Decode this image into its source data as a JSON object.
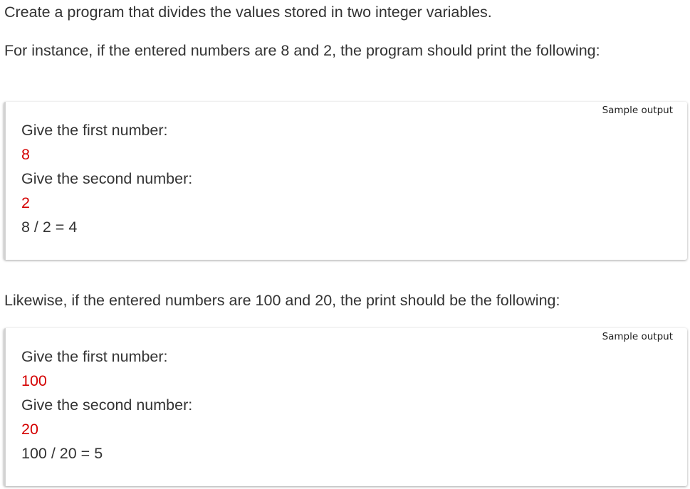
{
  "intro": "Create a program that divides the values stored in two integer variables.",
  "example1_text": "For instance, if the entered numbers are 8 and 2, the program should print the following:",
  "sample1": {
    "label": "Sample output",
    "lines": [
      {
        "text": "Give the first number:",
        "kind": "prompt"
      },
      {
        "text": "8",
        "kind": "input"
      },
      {
        "text": "Give the second number:",
        "kind": "prompt"
      },
      {
        "text": "2",
        "kind": "input"
      },
      {
        "text": "8 / 2 = 4",
        "kind": "output"
      }
    ]
  },
  "example2_text": "Likewise, if the entered numbers are 100 and 20, the print should be the following:",
  "sample2": {
    "label": "Sample output",
    "lines": [
      {
        "text": "Give the first number:",
        "kind": "prompt"
      },
      {
        "text": "100",
        "kind": "input"
      },
      {
        "text": "Give the second number:",
        "kind": "prompt"
      },
      {
        "text": "20",
        "kind": "input"
      },
      {
        "text": "100 / 20 = 5",
        "kind": "output"
      }
    ]
  },
  "colors": {
    "text": "#333333",
    "user_input": "#d40000",
    "box_border": "#d2d2d2"
  }
}
